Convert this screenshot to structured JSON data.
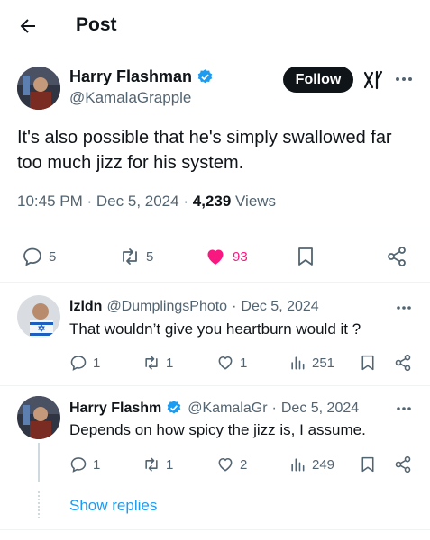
{
  "header": {
    "title": "Post",
    "back_icon": "arrow-left-icon"
  },
  "post": {
    "author_name": "Harry Flashman",
    "author_handle": "@KamalaGrapple",
    "verified": true,
    "follow_label": "Follow",
    "text": "It's also possible that he's simply swallowed far too much jizz for his system.",
    "time": "10:45 PM",
    "date": "Dec 5, 2024",
    "views": "4,239",
    "views_label": "Views",
    "sep": "·",
    "stats": {
      "replies": "5",
      "reposts": "5",
      "likes": "93"
    }
  },
  "replies": [
    {
      "name": "lzldn",
      "handle": "@DumplingsPhoto",
      "date": "Dec 5, 2024",
      "text": "That wouldn’t give you  heartburn would it ?",
      "stats": {
        "replies": "1",
        "reposts": "1",
        "likes": "1",
        "views": "251"
      }
    },
    {
      "name": "Harry Flashm",
      "handle": "@KamalaGr",
      "date": "Dec 5, 2024",
      "text": "Depends on how spicy the jizz is, I assume.",
      "stats": {
        "replies": "1",
        "reposts": "1",
        "likes": "2",
        "views": "249"
      }
    }
  ],
  "show_replies_label": "Show replies",
  "colors": {
    "accent": "#1d9bf0",
    "like": "#f91880",
    "text": "#0f1419",
    "muted": "#536471"
  }
}
